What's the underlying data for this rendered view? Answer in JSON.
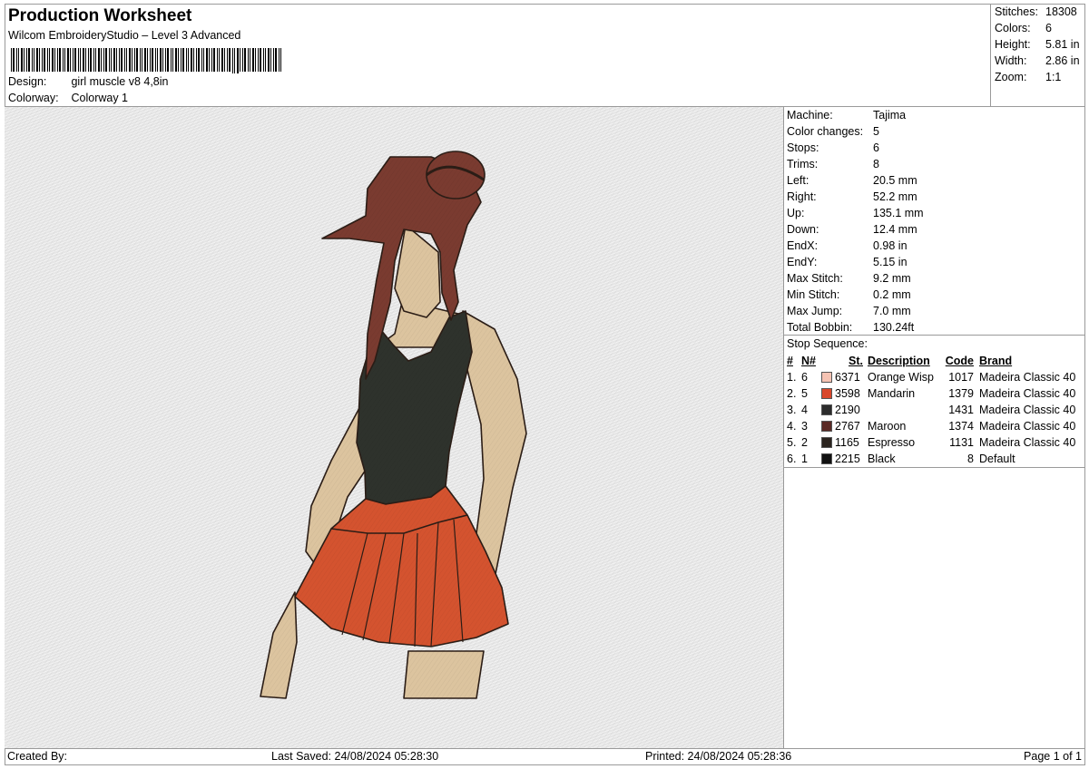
{
  "header": {
    "title": "Production Worksheet",
    "software": "Wilcom EmbroideryStudio – Level 3 Advanced",
    "design_label": "Design:",
    "design_value": "girl muscle v8 4,8in",
    "colorway_label": "Colorway:",
    "colorway_value": "Colorway 1"
  },
  "summary": [
    {
      "label": "Stitches:",
      "value": "18308"
    },
    {
      "label": "Colors:",
      "value": "6"
    },
    {
      "label": "Height:",
      "value": "5.81 in"
    },
    {
      "label": "Width:",
      "value": "2.86 in"
    },
    {
      "label": "Zoom:",
      "value": "1:1"
    }
  ],
  "details": [
    {
      "label": "Machine:",
      "value": "Tajima"
    },
    {
      "label": "Color changes:",
      "value": "5"
    },
    {
      "label": "Stops:",
      "value": "6"
    },
    {
      "label": "Trims:",
      "value": "8"
    },
    {
      "label": "Left:",
      "value": "20.5 mm"
    },
    {
      "label": "Right:",
      "value": "52.2 mm"
    },
    {
      "label": "Up:",
      "value": "135.1 mm"
    },
    {
      "label": "Down:",
      "value": "12.4 mm"
    },
    {
      "label": "EndX:",
      "value": "0.98 in"
    },
    {
      "label": "EndY:",
      "value": "5.15 in"
    },
    {
      "label": "Max Stitch:",
      "value": "9.2 mm"
    },
    {
      "label": "Min Stitch:",
      "value": "0.2 mm"
    },
    {
      "label": "Max Jump:",
      "value": "7.0 mm"
    },
    {
      "label": "Total Bobbin:",
      "value": "130.24ft"
    }
  ],
  "stop_sequence": {
    "title": "Stop Sequence:",
    "headers": {
      "idx": "#",
      "n": "N#",
      "st": "St.",
      "desc": "Description",
      "code": "Code",
      "brand": "Brand"
    },
    "rows": [
      {
        "idx": "1.",
        "n": "6",
        "color": "#f6c3b3",
        "st": "6371",
        "desc": "Orange Wisp",
        "code": "1017",
        "brand": "Madeira Classic 40"
      },
      {
        "idx": "2.",
        "n": "5",
        "color": "#d9472b",
        "st": "3598",
        "desc": "Mandarin",
        "code": "1379",
        "brand": "Madeira Classic 40"
      },
      {
        "idx": "3.",
        "n": "4",
        "color": "#2c2c2c",
        "st": "2190",
        "desc": "",
        "code": "1431",
        "brand": "Madeira Classic 40"
      },
      {
        "idx": "4.",
        "n": "3",
        "color": "#5a2a25",
        "st": "2767",
        "desc": "Maroon",
        "code": "1374",
        "brand": "Madeira Classic 40"
      },
      {
        "idx": "5.",
        "n": "2",
        "color": "#2b241f",
        "st": "1165",
        "desc": "Espresso",
        "code": "1131",
        "brand": "Madeira Classic 40"
      },
      {
        "idx": "6.",
        "n": "1",
        "color": "#111111",
        "st": "2215",
        "desc": "Black",
        "code": "8",
        "brand": "Default"
      }
    ]
  },
  "footer": {
    "created_by": "Created By:",
    "last_saved": "Last Saved: 24/08/2024 05:28:30",
    "printed": "Printed: 24/08/2024 05:28:36",
    "page": "Page 1 of 1"
  }
}
